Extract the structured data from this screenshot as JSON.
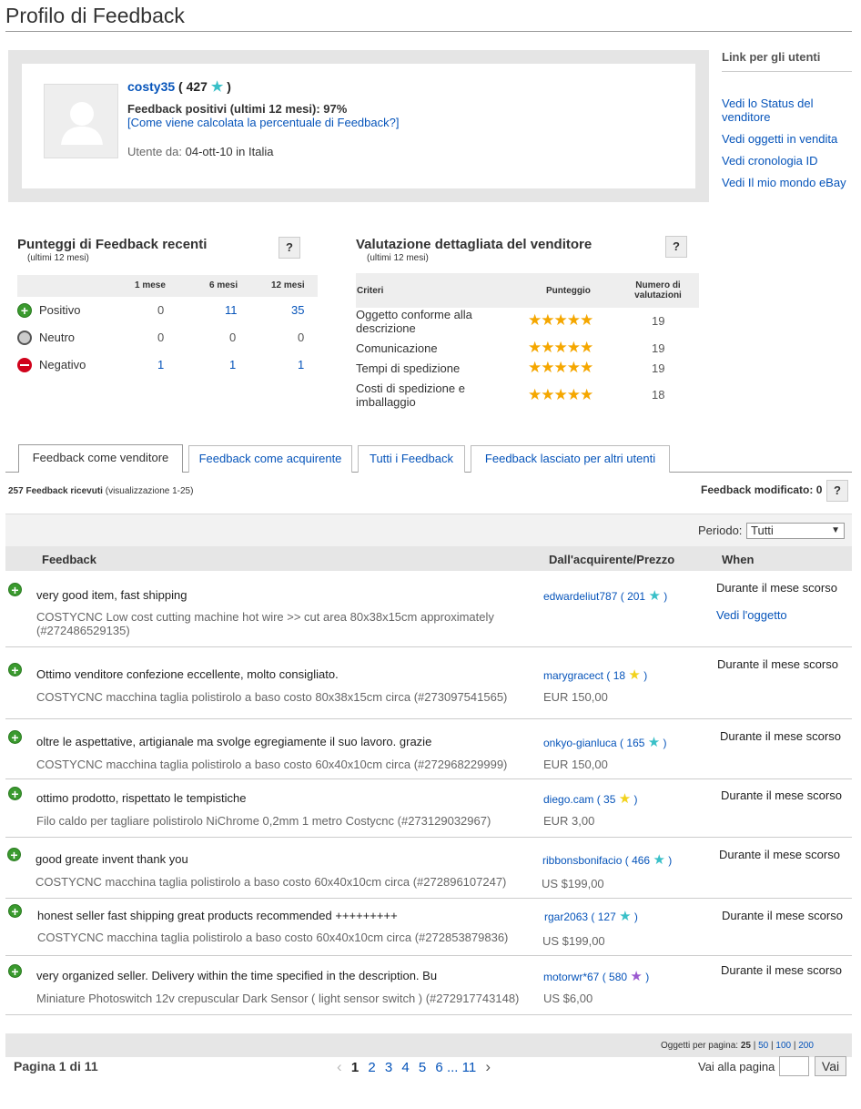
{
  "page": {
    "title": "Profilo di Feedback"
  },
  "profile": {
    "username": "costy35",
    "score": "427",
    "fb_label": "Feedback positivi (ultimi 12 mesi): 97%",
    "calc_link": "[Come viene calcolata la percentuale di Feedback?]",
    "member_label": "Utente da:",
    "member_value": "04-ott-10 in Italia"
  },
  "side": {
    "title": "Link per gli utenti",
    "links": [
      "Vedi lo Status del venditore",
      "Vedi oggetti in vendita",
      "Vedi cronologia ID",
      "Vedi Il mio mondo eBay"
    ]
  },
  "recent": {
    "title": "Punteggi di Feedback recenti",
    "subtitle": "(ultimi 12 mesi)",
    "help": "?",
    "cols": [
      "1 mese",
      "6 mesi",
      "12 mesi"
    ],
    "rows": [
      {
        "label": "Positivo",
        "v": [
          "0",
          "11",
          "35"
        ]
      },
      {
        "label": "Neutro",
        "v": [
          "0",
          "0",
          "0"
        ]
      },
      {
        "label": "Negativo",
        "v": [
          "1",
          "1",
          "1"
        ]
      }
    ]
  },
  "dsr": {
    "title": "Valutazione dettagliata del venditore",
    "subtitle": "(ultimi 12 mesi)",
    "help": "?",
    "h_criteria": "Criteri",
    "h_score": "Punteggio",
    "h_count": "Numero di valutazioni",
    "rows": [
      {
        "label": "Oggetto conforme alla descrizione",
        "stars": "★★★★★",
        "rating": 4.9,
        "count": "19"
      },
      {
        "label": "Comunicazione",
        "stars": "★★★★★",
        "rating": 4.7,
        "count": "19"
      },
      {
        "label": "Tempi di spedizione",
        "stars": "★★★★★",
        "rating": 5,
        "count": "19"
      },
      {
        "label": "Costi di spedizione e imballaggio",
        "stars": "★★★★★",
        "rating": 5,
        "count": "18"
      }
    ]
  },
  "tabs": [
    "Feedback come venditore",
    "Feedback come acquirente",
    "Tutti i Feedback",
    "Feedback lasciato per altri utenti"
  ],
  "summary": {
    "count": "257 Feedback ricevuti",
    "range": "(visualizzazione 1-25)",
    "modified": "Feedback modificato: 0",
    "help": "?"
  },
  "filter": {
    "label": "Periodo:",
    "value": "Tutti"
  },
  "columns": {
    "feedback": "Feedback",
    "buyer": "Dall'acquirente/Prezzo",
    "when": "When"
  },
  "rows": [
    {
      "text": "very good item, fast shipping",
      "item": "COSTYCNC Low cost cutting machine hot wire >> cut area 80x38x15cm approximately (#272486529135)",
      "buyer": "edwardeliut787",
      "score": "201",
      "star_color": "#39c0c8",
      "price": "",
      "when": "Durante il mese scorso",
      "view": "Vedi l'oggetto"
    },
    {
      "text": "Ottimo venditore confezione eccellente, molto consigliato.",
      "item": "COSTYCNC macchina taglia polistirolo a baso costo 80x38x15cm circa (#273097541565)",
      "buyer": "marygracect",
      "score": "18",
      "star_color": "#f2d21b",
      "price": "EUR 150,00",
      "when": "Durante il mese scorso",
      "view": ""
    },
    {
      "text": "oltre le aspettative, artigianale ma svolge egregiamente il suo lavoro. grazie",
      "item": "COSTYCNC macchina taglia polistirolo a baso costo 60x40x10cm circa (#272968229999)",
      "buyer": "onkyo-gianluca",
      "score": "165",
      "star_color": "#39c0c8",
      "price": "EUR 150,00",
      "when": "Durante il mese scorso",
      "view": ""
    },
    {
      "text": "ottimo prodotto, rispettato le tempistiche",
      "item": "Filo caldo per tagliare polistirolo NiChrome 0,2mm 1 metro Costycnc (#273129032967)",
      "buyer": "diego.cam",
      "score": "35",
      "star_color": "#f2d21b",
      "price": "EUR 3,00",
      "when": "Durante il mese scorso",
      "view": ""
    },
    {
      "text": "good greate invent thank you",
      "item": "COSTYCNC macchina taglia polistirolo a baso costo 60x40x10cm circa (#272896107247)",
      "buyer": "ribbonsbonifacio",
      "score": "466",
      "star_color": "#39c0c8",
      "price": "US $199,00",
      "when": "Durante il mese scorso",
      "view": ""
    },
    {
      "text": "honest seller fast shipping great products recommended +++++++++",
      "item": "COSTYCNC macchina taglia polistirolo a baso costo 60x40x10cm circa (#272853879836)",
      "buyer": "rgar2063",
      "score": "127",
      "star_color": "#39c0c8",
      "price": "US $199,00",
      "when": "Durante il mese scorso",
      "view": ""
    },
    {
      "text": "very organized seller. Delivery within the time specified in the description. Bu",
      "item": "Miniature Photoswitch 12v crepuscular Dark Sensor ( light sensor switch ) (#272917743148)",
      "buyer": "motorwr*67",
      "score": "580",
      "star_color": "#9b59d0",
      "price": "US $6,00",
      "when": "Durante il mese scorso",
      "view": ""
    }
  ],
  "pager": {
    "per_page_label": "Oggetti per pagina:",
    "per_page": [
      "25",
      "50",
      "100",
      "200"
    ],
    "page_label": "Pagina 1 di 11",
    "pages": [
      "1",
      "2",
      "3",
      "4",
      "5",
      "6",
      "...",
      "11"
    ],
    "goto_label": "Vai alla pagina",
    "goto_button": "Vai"
  }
}
